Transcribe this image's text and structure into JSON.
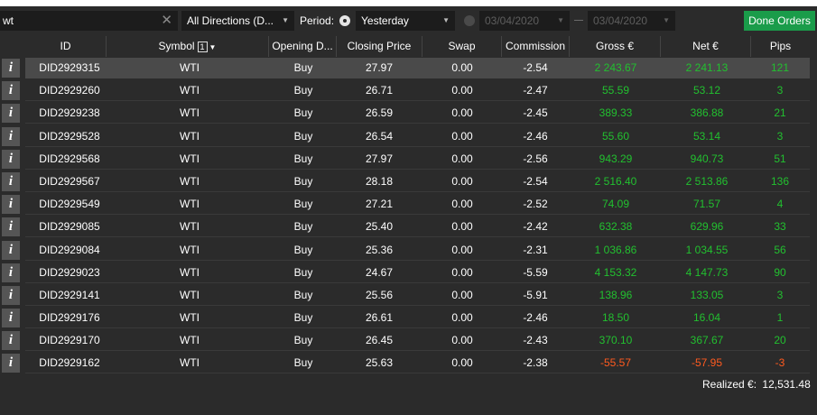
{
  "toolbar": {
    "search_value": "wt",
    "direction": "All Directions (D...",
    "period_label": "Period:",
    "period_value": "Yesterday",
    "date_from": "03/04/2020",
    "date_to": "03/04/2020",
    "done_orders_label": "Done Orders"
  },
  "columns": {
    "id": "ID",
    "symbol": "Symbol",
    "symbol_sort_index": "1",
    "opening": "Opening D...",
    "closing": "Closing Price",
    "swap": "Swap",
    "commission": "Commission",
    "gross": "Gross €",
    "net": "Net €",
    "pips": "Pips"
  },
  "rows": [
    {
      "id": "DID2929315",
      "symbol": "WTI",
      "direction": "Buy",
      "closing": "27.97",
      "swap": "0.00",
      "commission": "-2.54",
      "gross": "2 243.67",
      "net": "2 241.13",
      "pips": "121",
      "sign": "pos"
    },
    {
      "id": "DID2929260",
      "symbol": "WTI",
      "direction": "Buy",
      "closing": "26.71",
      "swap": "0.00",
      "commission": "-2.47",
      "gross": "55.59",
      "net": "53.12",
      "pips": "3",
      "sign": "pos"
    },
    {
      "id": "DID2929238",
      "symbol": "WTI",
      "direction": "Buy",
      "closing": "26.59",
      "swap": "0.00",
      "commission": "-2.45",
      "gross": "389.33",
      "net": "386.88",
      "pips": "21",
      "sign": "pos"
    },
    {
      "id": "DID2929528",
      "symbol": "WTI",
      "direction": "Buy",
      "closing": "26.54",
      "swap": "0.00",
      "commission": "-2.46",
      "gross": "55.60",
      "net": "53.14",
      "pips": "3",
      "sign": "pos"
    },
    {
      "id": "DID2929568",
      "symbol": "WTI",
      "direction": "Buy",
      "closing": "27.97",
      "swap": "0.00",
      "commission": "-2.56",
      "gross": "943.29",
      "net": "940.73",
      "pips": "51",
      "sign": "pos"
    },
    {
      "id": "DID2929567",
      "symbol": "WTI",
      "direction": "Buy",
      "closing": "28.18",
      "swap": "0.00",
      "commission": "-2.54",
      "gross": "2 516.40",
      "net": "2 513.86",
      "pips": "136",
      "sign": "pos"
    },
    {
      "id": "DID2929549",
      "symbol": "WTI",
      "direction": "Buy",
      "closing": "27.21",
      "swap": "0.00",
      "commission": "-2.52",
      "gross": "74.09",
      "net": "71.57",
      "pips": "4",
      "sign": "pos"
    },
    {
      "id": "DID2929085",
      "symbol": "WTI",
      "direction": "Buy",
      "closing": "25.40",
      "swap": "0.00",
      "commission": "-2.42",
      "gross": "632.38",
      "net": "629.96",
      "pips": "33",
      "sign": "pos"
    },
    {
      "id": "DID2929084",
      "symbol": "WTI",
      "direction": "Buy",
      "closing": "25.36",
      "swap": "0.00",
      "commission": "-2.31",
      "gross": "1 036.86",
      "net": "1 034.55",
      "pips": "56",
      "sign": "pos"
    },
    {
      "id": "DID2929023",
      "symbol": "WTI",
      "direction": "Buy",
      "closing": "24.67",
      "swap": "0.00",
      "commission": "-5.59",
      "gross": "4 153.32",
      "net": "4 147.73",
      "pips": "90",
      "sign": "pos"
    },
    {
      "id": "DID2929141",
      "symbol": "WTI",
      "direction": "Buy",
      "closing": "25.56",
      "swap": "0.00",
      "commission": "-5.91",
      "gross": "138.96",
      "net": "133.05",
      "pips": "3",
      "sign": "pos"
    },
    {
      "id": "DID2929176",
      "symbol": "WTI",
      "direction": "Buy",
      "closing": "26.61",
      "swap": "0.00",
      "commission": "-2.46",
      "gross": "18.50",
      "net": "16.04",
      "pips": "1",
      "sign": "pos"
    },
    {
      "id": "DID2929170",
      "symbol": "WTI",
      "direction": "Buy",
      "closing": "26.45",
      "swap": "0.00",
      "commission": "-2.43",
      "gross": "370.10",
      "net": "367.67",
      "pips": "20",
      "sign": "pos"
    },
    {
      "id": "DID2929162",
      "symbol": "WTI",
      "direction": "Buy",
      "closing": "25.63",
      "swap": "0.00",
      "commission": "-2.38",
      "gross": "-55.57",
      "net": "-57.95",
      "pips": "-3",
      "sign": "neg"
    }
  ],
  "info_glyph": "i",
  "footer": {
    "realized_label": "Realized €:",
    "realized_value": "12,531.48"
  },
  "colors": {
    "accent_button": "#1a9c4a",
    "positive": "#22c02f",
    "negative": "#ff5a1f"
  }
}
